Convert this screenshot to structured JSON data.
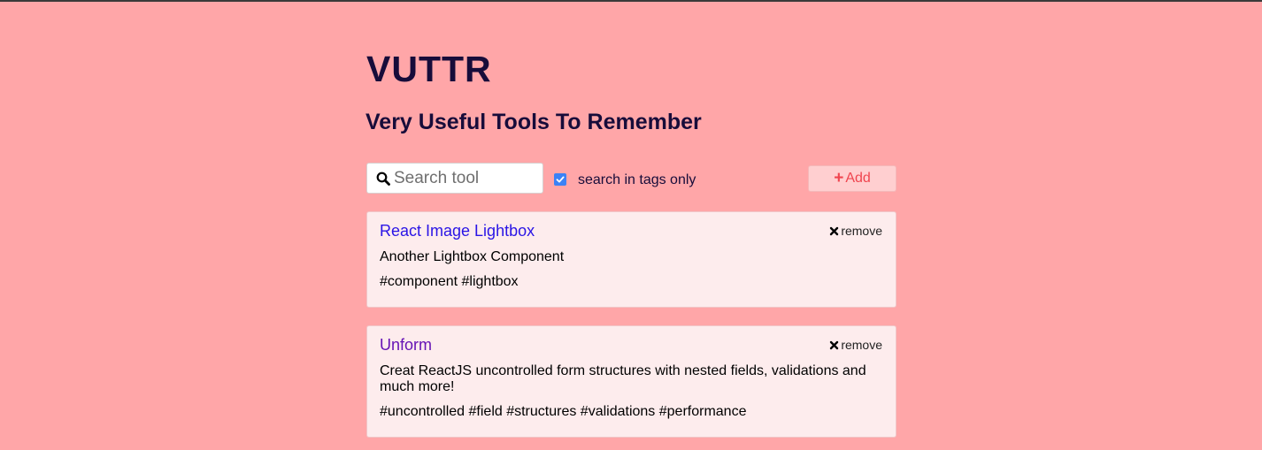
{
  "header": {
    "title": "VUTTR",
    "subtitle": "Very Useful Tools To Remember"
  },
  "toolbar": {
    "search_placeholder": "Search tool",
    "search_value": "",
    "tags_only_checked": true,
    "tags_only_label": "search in tags only",
    "add_label": "Add"
  },
  "tools": [
    {
      "title": "React Image Lightbox",
      "remove_label": "remove",
      "description": "Another Lightbox Component",
      "tags": "#component #lightbox"
    },
    {
      "title": "Unform",
      "remove_label": "remove",
      "description": "Creat ReactJS uncontrolled form structures with nested fields, validations and much more!",
      "tags": "#uncontrolled #field #structures #validations #performance"
    }
  ],
  "icons": {
    "search": "search-icon",
    "check": "check-icon",
    "plus": "plus-icon",
    "remove": "close-icon"
  },
  "colors": {
    "background": "#ffa6a8",
    "title": "#170c3a",
    "card_background": "#fdeced",
    "add_text": "#f0454f",
    "link_unvisited": "#2a14e6",
    "link_visited": "#6613b5",
    "checkbox": "#3b82f6"
  }
}
